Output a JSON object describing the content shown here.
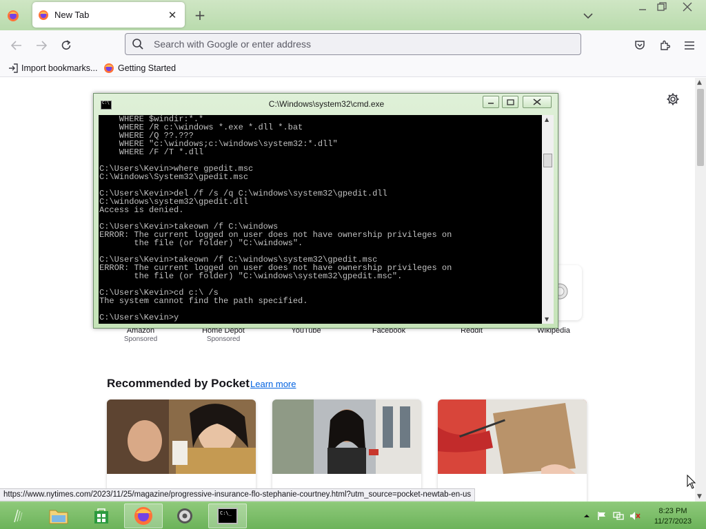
{
  "browser": {
    "tab_title": "New Tab",
    "url_placeholder": "Search with Google or enter address",
    "bookmarks": [
      {
        "label": "Import bookmarks..."
      },
      {
        "label": "Getting Started"
      }
    ]
  },
  "newtab": {
    "shortcuts": [
      {
        "label": "Amazon",
        "sub": "Sponsored"
      },
      {
        "label": "Home Depot",
        "sub": "Sponsored"
      },
      {
        "label": "YouTube",
        "sub": ""
      },
      {
        "label": "Facebook",
        "sub": ""
      },
      {
        "label": "Reddit",
        "sub": ""
      },
      {
        "label": "Wikipedia",
        "sub": ""
      }
    ],
    "pocket_heading": "Recommended by Pocket",
    "pocket_learn_more": "Learn more"
  },
  "status_bar_url": "https://www.nytimes.com/2023/11/25/magazine/progressive-insurance-flo-stephanie-courtney.html?utm_source=pocket-newtab-en-us",
  "cmd": {
    "title": "C:\\Windows\\system32\\cmd.exe",
    "lines": [
      "    WHERE $windir:*.*",
      "    WHERE /R c:\\windows *.exe *.dll *.bat",
      "    WHERE /Q ??.???",
      "    WHERE \"c:\\windows;c:\\windows\\system32:*.dll\"",
      "    WHERE /F /T *.dll",
      "",
      "C:\\Users\\Kevin>where gpedit.msc",
      "C:\\Windows\\System32\\gpedit.msc",
      "",
      "C:\\Users\\Kevin>del /f /s /q C:\\windows\\system32\\gpedit.dll",
      "C:\\windows\\system32\\gpedit.dll",
      "Access is denied.",
      "",
      "C:\\Users\\Kevin>takeown /f C:\\windows",
      "ERROR: The current logged on user does not have ownership privileges on",
      "       the file (or folder) \"C:\\windows\".",
      "",
      "C:\\Users\\Kevin>takeown /f C:\\windows\\system32\\gpedit.msc",
      "ERROR: The current logged on user does not have ownership privileges on",
      "       the file (or folder) \"C:\\windows\\system32\\gpedit.msc\".",
      "",
      "C:\\Users\\Kevin>cd c:\\ /s",
      "The system cannot find the path specified.",
      "",
      "C:\\Users\\Kevin>y"
    ]
  },
  "taskbar": {
    "cmd_icon_text": "C:\\_",
    "clock_time": "8:23 PM",
    "clock_date": "11/27/2023"
  },
  "colors": {
    "tabstrip": "#b9dbad",
    "taskbar": "#6cb35a",
    "link": "#0061e0"
  }
}
